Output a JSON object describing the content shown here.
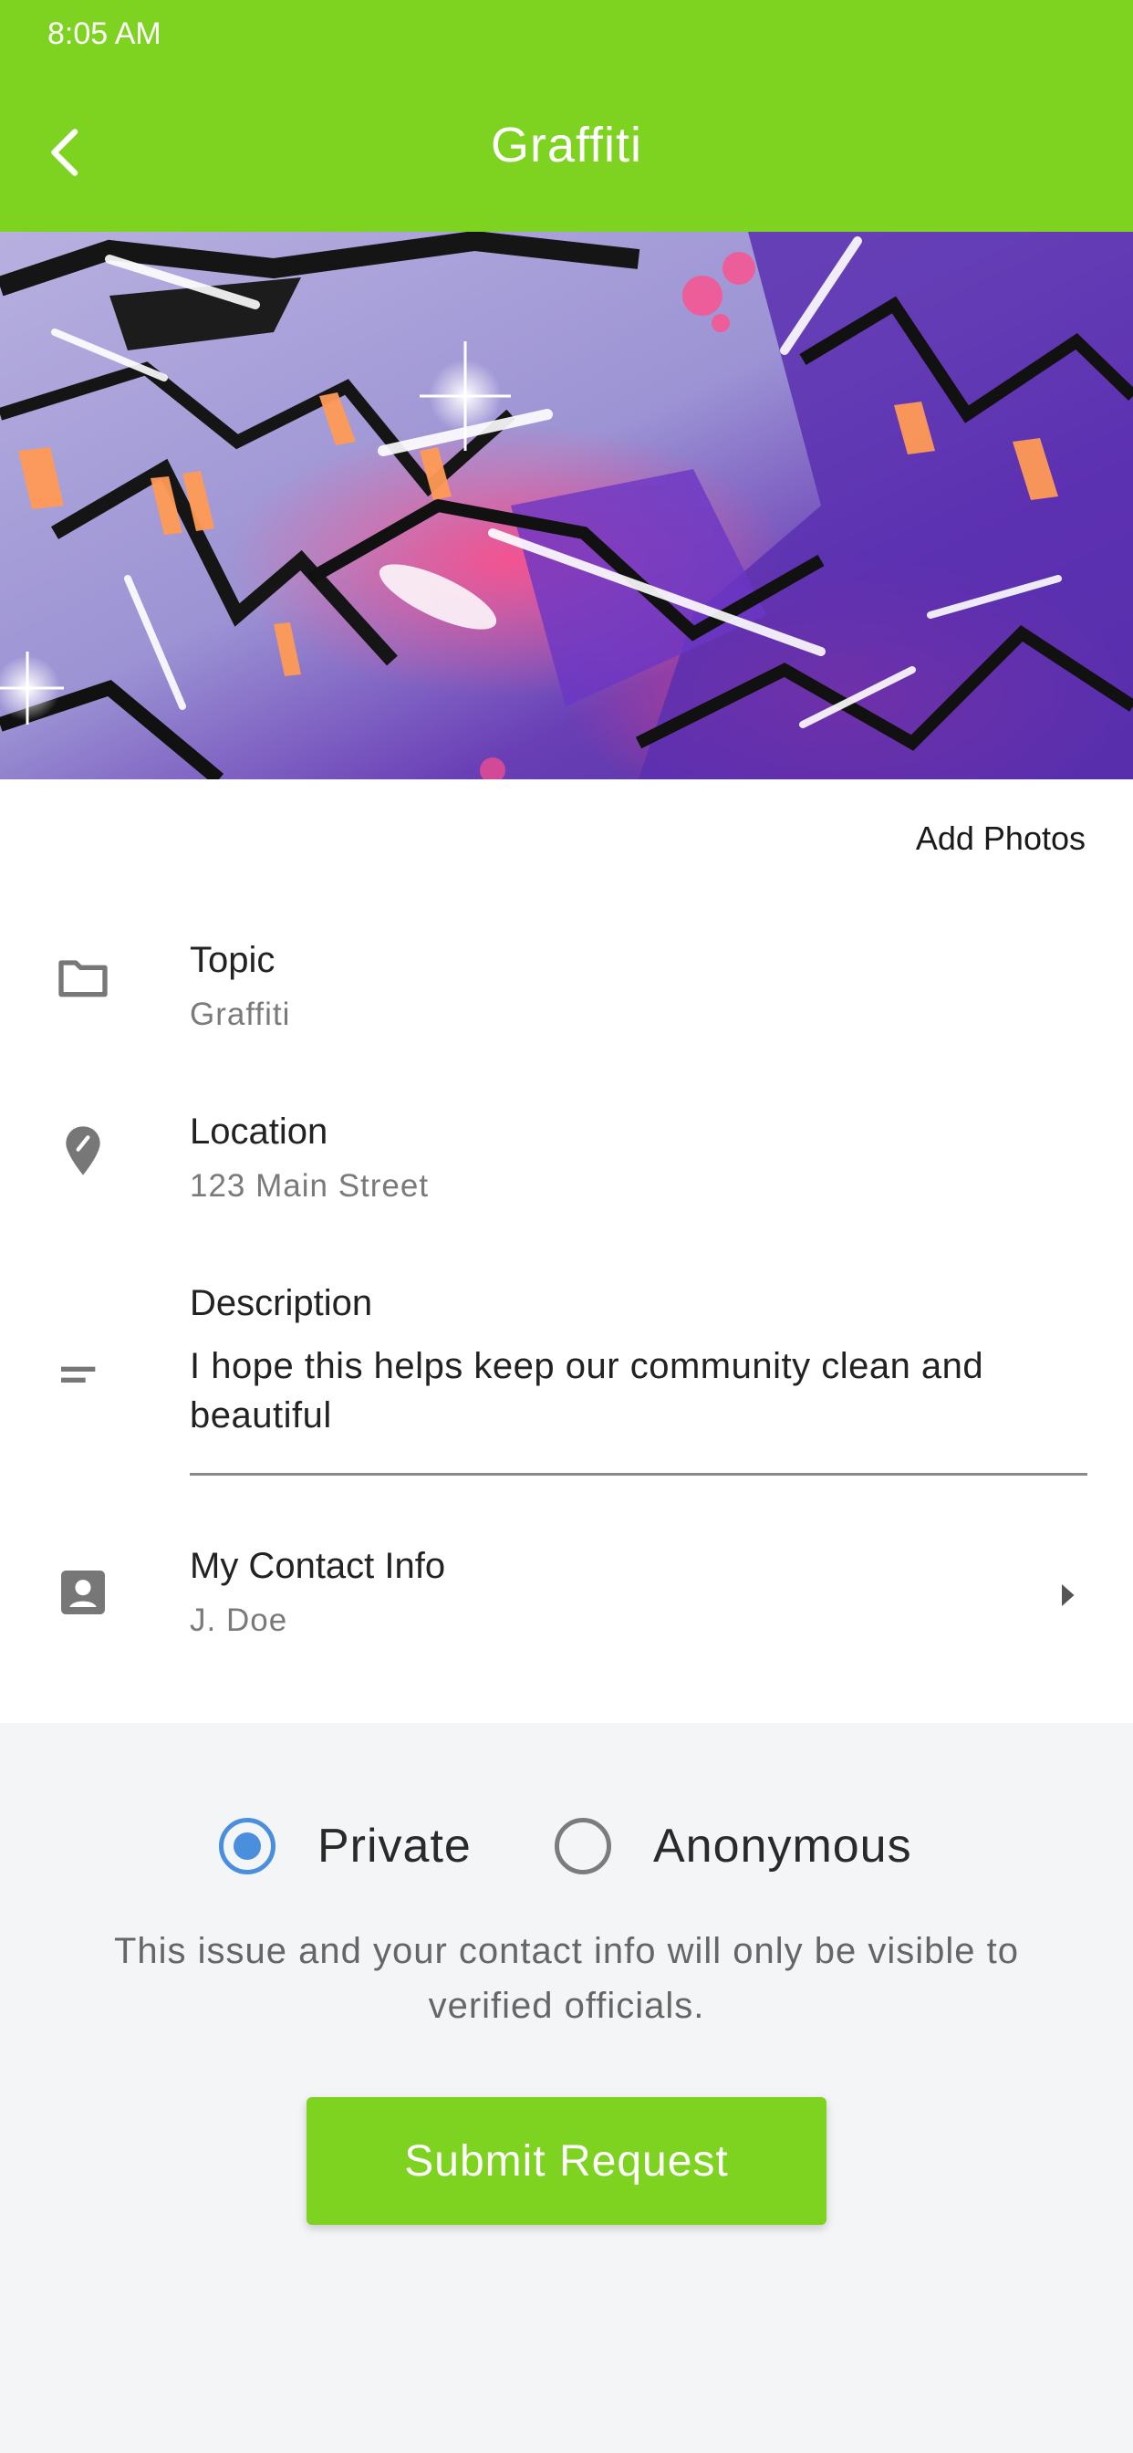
{
  "status_bar": {
    "time": "8:05 AM"
  },
  "header": {
    "title": "Graffiti",
    "back_icon": "chevron-left-icon"
  },
  "colors": {
    "accent": "#7ed321",
    "radio_selected": "#4a8fde"
  },
  "hero": {
    "subject": "graffiti photo"
  },
  "add_photos_label": "Add Photos",
  "fields": {
    "topic": {
      "label": "Topic",
      "value": "Graffiti",
      "icon": "folder-icon"
    },
    "location": {
      "label": "Location",
      "value": "123 Main Street",
      "icon": "location-pin-icon"
    },
    "description": {
      "label": "Description",
      "value": "I hope this helps keep our community clean and beautiful",
      "icon": "short-text-icon"
    },
    "contact": {
      "label": "My Contact Info",
      "value": "J. Doe",
      "icon": "contact-card-icon"
    }
  },
  "privacy": {
    "options": [
      {
        "label": "Private",
        "selected": true
      },
      {
        "label": "Anonymous",
        "selected": false
      }
    ],
    "notice": "This issue and your contact info will only be visible to verified officials."
  },
  "submit_label": "Submit Request"
}
